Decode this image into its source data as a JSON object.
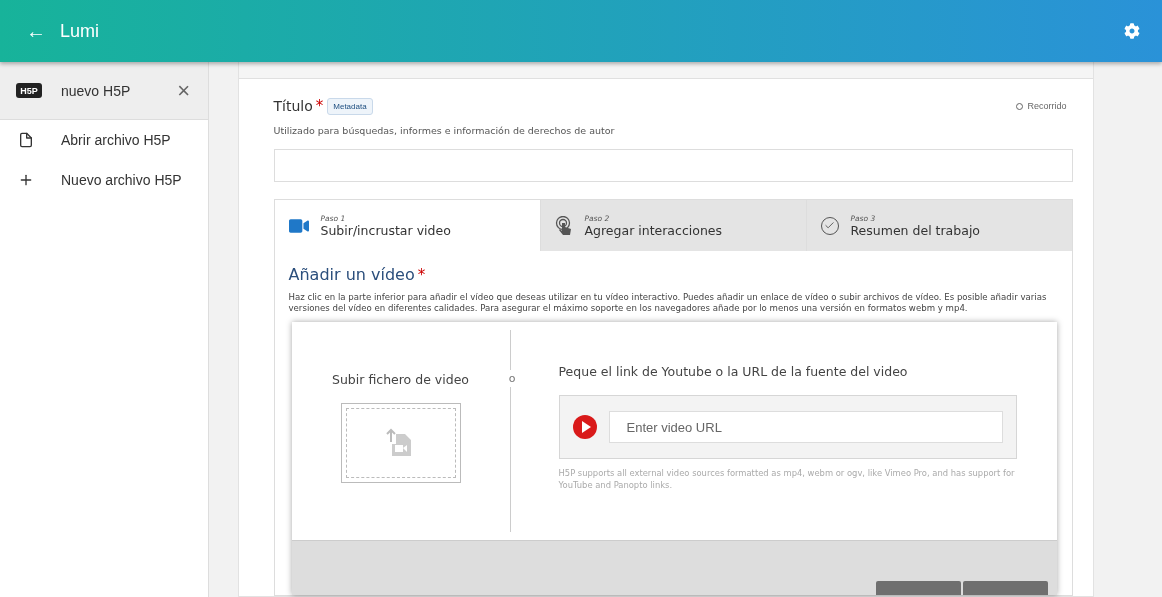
{
  "app_bar": {
    "back": "←",
    "title": "Lumi"
  },
  "sidebar": {
    "items": [
      {
        "kind": "file",
        "label": "nuevo H5P",
        "logo": "H5P",
        "selected": true,
        "close": "×"
      },
      {
        "kind": "open",
        "label": "Abrir archivo H5P",
        "selected": false
      },
      {
        "kind": "new",
        "label": "Nuevo archivo H5P",
        "selected": false
      }
    ]
  },
  "title_field": {
    "label": "Título",
    "required_mark": "*",
    "metadata": "Metadata",
    "tour": "Recorrido",
    "description": "Utilizado para búsquedas, informes e información de derechos de autor"
  },
  "steps": [
    {
      "step": "Paso 1",
      "label": "Subir/incrustar video",
      "kind": "video",
      "selected": true
    },
    {
      "step": "Paso 2",
      "label": "Agregar interacciones",
      "kind": "touch",
      "selected": false
    },
    {
      "step": "Paso 3",
      "label": "Resumen del trabajo",
      "kind": "check",
      "selected": false
    }
  ],
  "video_section": {
    "heading": "Añadir un vídeo",
    "required_mark": "*",
    "description": "Haz clic en la parte inferior para añadir el vídeo que deseas utilizar en tu vídeo interactivo. Puedes añadir un enlace de vídeo o subir archivos de vídeo. Es posible añadir varias versiones del vídeo en diferentes calidades. Para asegurar el máximo soporte en los navegadores añade por lo menos una versión en formatos webm y mp4."
  },
  "dialog": {
    "upload_label": "Subir fichero de video",
    "or": "o",
    "url_label": "Peque el link de Youtube o la URL de la fuente del video",
    "placeholder": "Enter video URL",
    "hint": "H5P supports all external video sources formatted as mp4, webm or ogv, like Vimeo Pro, and has support for YouTube and Panopto links."
  }
}
